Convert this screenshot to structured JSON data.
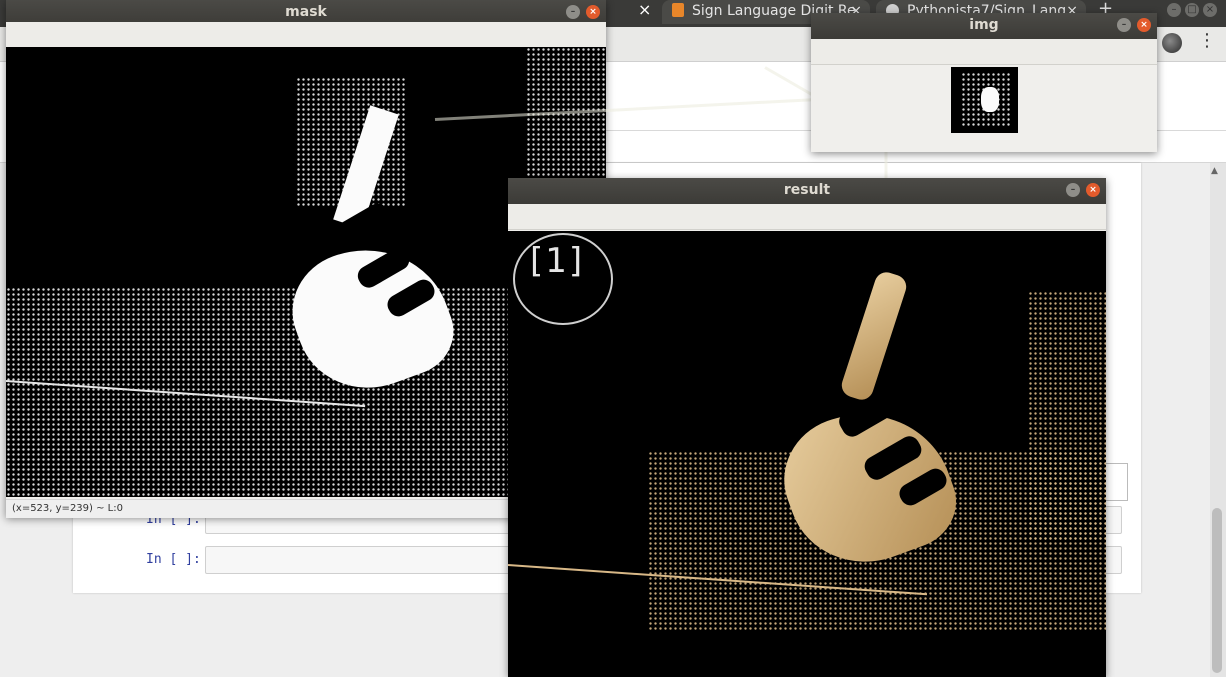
{
  "browser": {
    "tabs": [
      {
        "title": "Sign Language Digit Re",
        "active": false
      },
      {
        "title": "Pythonista7/Sign_Lang",
        "active": false
      }
    ],
    "new_tab_label": "+",
    "tab_close_glyph": "×"
  },
  "notebook": {
    "cells": [
      {
        "prompt": "In [ ]:"
      },
      {
        "prompt": "In [ ]:"
      }
    ]
  },
  "windows": {
    "mask": {
      "title": "mask",
      "status": "(x=523, y=239) ~ L:0"
    },
    "img": {
      "title": "img"
    },
    "result": {
      "title": "result",
      "step_label": "[1]"
    }
  },
  "icons": {
    "window_close": "×",
    "window_minimize": "–",
    "menu": "⋮"
  },
  "colors": {
    "titlebar": "#3c3b37",
    "close_button": "#e35b2c",
    "prompt_text": "#303f9f"
  }
}
